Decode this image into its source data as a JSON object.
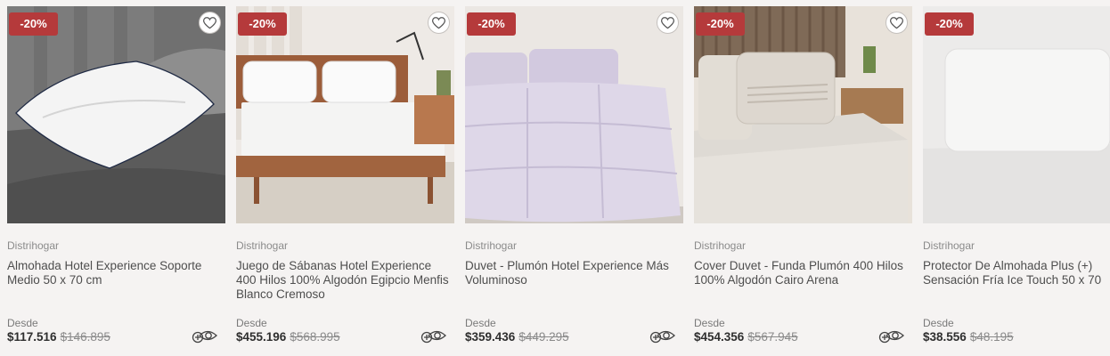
{
  "colors": {
    "badge": "#b53a3b",
    "background": "#f5f3f2",
    "price": "#2e2e2e"
  },
  "products": [
    {
      "badge": "-20%",
      "brand": "Distrihogar",
      "name": "Almohada Hotel Experience Soporte Medio 50 x 70 cm",
      "desde": "Desde",
      "price": "$117.516",
      "old_price": "$146.895",
      "icons": [
        "heart-icon",
        "quick-view-icon"
      ]
    },
    {
      "badge": "-20%",
      "brand": "Distrihogar",
      "name": "Juego de Sábanas Hotel Experience 400 Hilos 100% Algodón Egipcio Menfis Blanco Cremoso",
      "desde": "Desde",
      "price": "$455.196",
      "old_price": "$568.995",
      "icons": [
        "heart-icon",
        "quick-view-icon"
      ]
    },
    {
      "badge": "-20%",
      "brand": "Distrihogar",
      "name": "Duvet - Plumón Hotel Experience Más Voluminoso",
      "desde": "Desde",
      "price": "$359.436",
      "old_price": "$449.295",
      "icons": [
        "heart-icon",
        "quick-view-icon"
      ]
    },
    {
      "badge": "-20%",
      "brand": "Distrihogar",
      "name": "Cover Duvet - Funda Plumón 400 Hilos 100% Algodón Cairo Arena",
      "desde": "Desde",
      "price": "$454.356",
      "old_price": "$567.945",
      "icons": [
        "heart-icon",
        "quick-view-icon"
      ]
    },
    {
      "badge": "-20%",
      "brand": "Distrihogar",
      "name": "Protector De Almohada Plus (+) Sensación Fría Ice Touch 50 x 70",
      "desde": "Desde",
      "price": "$38.556",
      "old_price": "$48.195",
      "icons": []
    }
  ]
}
